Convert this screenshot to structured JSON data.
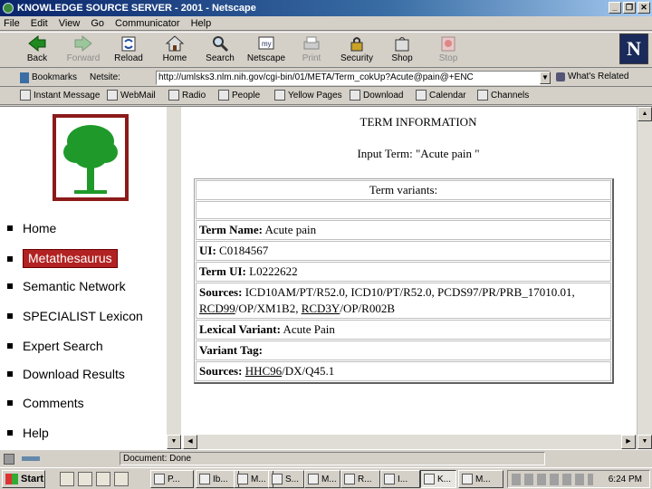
{
  "window": {
    "title": "KNOWLEDGE SOURCE SERVER - 2001 - Netscape"
  },
  "menu": [
    "File",
    "Edit",
    "View",
    "Go",
    "Communicator",
    "Help"
  ],
  "toolbar": [
    {
      "label": "Back",
      "icon": "back-arrow-icon",
      "enabled": true
    },
    {
      "label": "Forward",
      "icon": "forward-arrow-icon",
      "enabled": false
    },
    {
      "label": "Reload",
      "icon": "reload-icon",
      "enabled": true
    },
    {
      "label": "Home",
      "icon": "home-icon",
      "enabled": true
    },
    {
      "label": "Search",
      "icon": "search-icon",
      "enabled": true
    },
    {
      "label": "Netscape",
      "icon": "netscape-icon",
      "enabled": true
    },
    {
      "label": "Print",
      "icon": "print-icon",
      "enabled": false
    },
    {
      "label": "Security",
      "icon": "lock-icon",
      "enabled": true
    },
    {
      "label": "Shop",
      "icon": "shop-icon",
      "enabled": true
    },
    {
      "label": "Stop",
      "icon": "stop-icon",
      "enabled": false
    }
  ],
  "location": {
    "bookmarks": "Bookmarks",
    "netsite_label": "Netsite:",
    "url": "http://umlsks3.nlm.nih.gov/cgi-bin/01/META/Term_cokUp?Acute@pain@+ENC",
    "related": "What's Related"
  },
  "personal_bar": [
    "Instant Message",
    "WebMail",
    "Radio",
    "People",
    "Yellow Pages",
    "Download",
    "Calendar",
    "Channels"
  ],
  "nav": [
    {
      "label": "Home",
      "active": false
    },
    {
      "label": "Metathesaurus",
      "active": true
    },
    {
      "label": "Semantic Network",
      "active": false
    },
    {
      "label": "SPECIALIST Lexicon",
      "active": false
    },
    {
      "label": "Expert Search",
      "active": false
    },
    {
      "label": "Download Results",
      "active": false
    },
    {
      "label": "Comments",
      "active": false
    },
    {
      "label": "Help",
      "active": false
    }
  ],
  "page": {
    "heading": "TERM INFORMATION",
    "input_term": "Input Term: \"Acute pain \"",
    "variants_header": "Term variants:",
    "term_name_label": "Term Name:",
    "term_name": "Acute pain",
    "ui_label": "UI:",
    "ui": "C0184567",
    "term_ui_label": "Term UI:",
    "term_ui": "L0222622",
    "sources_label": "Sources:",
    "sources_1": "ICD10AM/PT/R52.0, ICD10/PT/R52.0, PCDS97/PR/PRB_17010.01,",
    "sources_1b_u1": "RCD99",
    "sources_1b_mid": "/OP/XM1B2, ",
    "sources_1b_u2": "RCD3Y",
    "sources_1b_end": "/OP/R002B",
    "lexvar_label": "Lexical Variant:",
    "lexvar": "Acute Pain",
    "vartag_label": "Variant Tag:",
    "sources_2_label": "Sources:",
    "sources_2_u": "HHC96",
    "sources_2_end": "/DX/Q45.1"
  },
  "status": {
    "text": "Document: Done"
  },
  "taskbar": {
    "start": "Start",
    "tasks": [
      "P...",
      "Ib...",
      "M...",
      "S...",
      "M...",
      "R...",
      "I...",
      "K...",
      "M..."
    ],
    "clock": "6:24 PM"
  }
}
